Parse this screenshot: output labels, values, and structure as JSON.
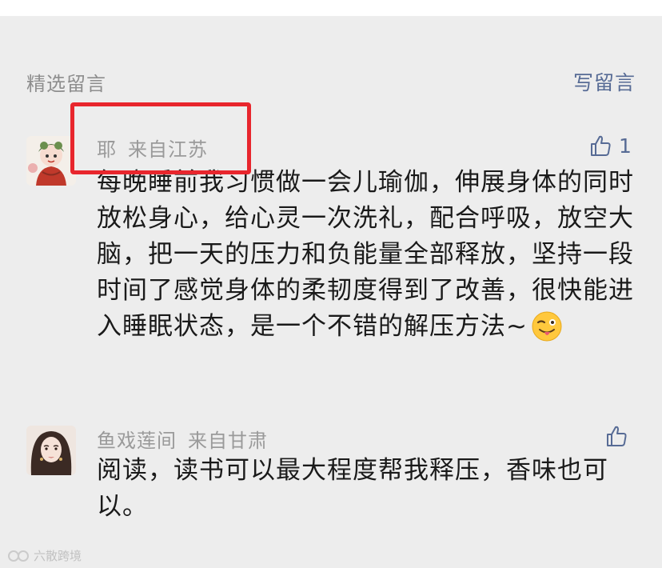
{
  "section": {
    "title": "精选留言",
    "write_label": "写留言"
  },
  "comments": [
    {
      "author": "耶",
      "location": "来自江苏",
      "likes": "1",
      "text": "每晚睡前我习惯做一会儿瑜伽，伸展身体的同时放松身心，给心灵一次洗礼，配合呼吸，放空大脑，把一天的压力和负能量全部释放，坚持一段时间了感觉身体的柔韧度得到了改善，很快能进入睡眠状态，是一个不错的解压方法~",
      "emoji": "winking-tongue-face"
    },
    {
      "author": "鱼戏莲间",
      "location": "来自甘肃",
      "likes": "",
      "text": "阅读，读书可以最大程度帮我释压，香味也可以。"
    }
  ],
  "watermark": {
    "text": "六散跨境"
  },
  "colors": {
    "accent": "#576b95",
    "highlight": "#e8262d",
    "background": "#ededed",
    "meta": "#9a9a9a",
    "text": "#1a1a1a"
  },
  "icons": {
    "like": "thumbs-up-icon"
  }
}
